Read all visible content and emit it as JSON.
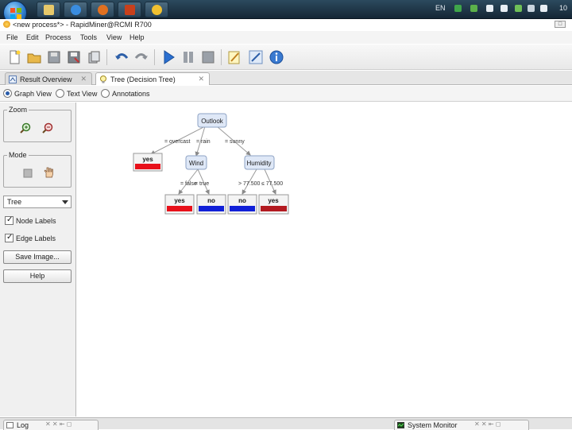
{
  "taskbar": {
    "tray_lang": "EN",
    "tray_clock": "10"
  },
  "window": {
    "title": "<new process*> - RapidMiner@RCMI R700"
  },
  "menu": [
    "File",
    "Edit",
    "Process",
    "Tools",
    "View",
    "Help"
  ],
  "tabs": [
    {
      "label": "Result Overview",
      "icon": "result-overview-icon",
      "close": "✕"
    },
    {
      "label": "Tree (Decision Tree)",
      "icon": "lightbulb-icon",
      "close": "✕"
    }
  ],
  "views": [
    {
      "label": "Graph View",
      "selected": true
    },
    {
      "label": "Text View",
      "selected": false
    },
    {
      "label": "Annotations",
      "selected": false
    }
  ],
  "left_panel": {
    "zoom_label": "Zoom",
    "mode_label": "Mode",
    "layout_select": "Tree",
    "node_labels": "Node Labels",
    "edge_labels": "Edge Labels",
    "save_image": "Save Image...",
    "help": "Help"
  },
  "tree": {
    "root": "Outlook",
    "edges": {
      "overcast": "= overcast",
      "rain": "= rain",
      "sunny": "= sunny",
      "false": "= false",
      "true": "= true",
      "gt": "> 77.500",
      "le": "≤ 77.500"
    },
    "nodes": {
      "wind": "Wind",
      "humidity": "Humidity",
      "leaf_overcast": "yes",
      "leaf_false": "yes",
      "leaf_true": "no",
      "leaf_gt": "no",
      "leaf_le": "yes"
    },
    "colors": {
      "yes": "#e8101a",
      "no": "#1020d8",
      "node_fill": "#dfe8f7",
      "node_border": "#8ea3c4"
    }
  },
  "bottom": {
    "log": "Log",
    "system_monitor": "System Monitor"
  }
}
